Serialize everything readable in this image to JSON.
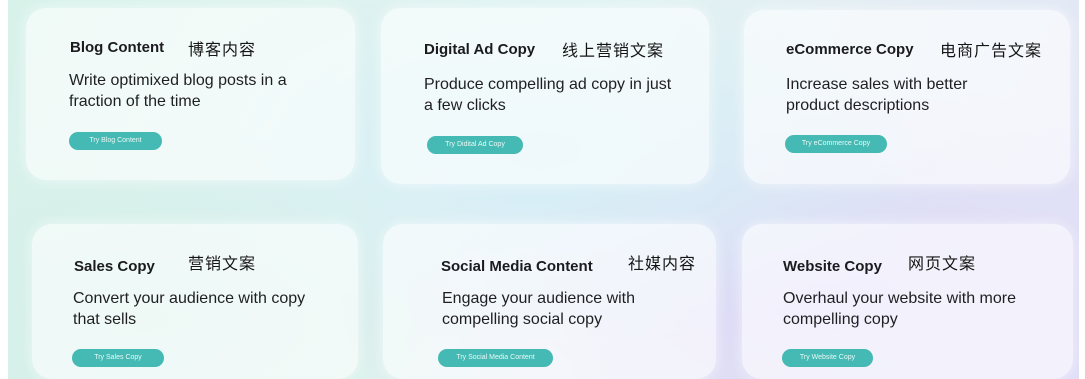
{
  "cards": [
    {
      "title": "Blog Content",
      "title_zh": "博客内容",
      "description": "Write optimixed blog posts in a fraction of the time",
      "button_label": "Try Blog Content"
    },
    {
      "title": "Digital Ad Copy",
      "title_zh": "线上营销文案",
      "description": "Produce compelling ad copy in just a few clicks",
      "button_label": "Try Didital Ad Copy"
    },
    {
      "title": "eCommerce Copy",
      "title_zh": "电商广告文案",
      "description": "Increase sales with better product descriptions",
      "button_label": "Try eCommerce Copy"
    },
    {
      "title": "Sales Copy",
      "title_zh": "营销文案",
      "description": "Convert your audience with copy that sells",
      "button_label": "Try Sales Copy"
    },
    {
      "title": "Social Media Content",
      "title_zh": "社媒内容",
      "description": "Engage your audience with compelling social copy",
      "button_label": "Try Social Media Content"
    },
    {
      "title": "Website Copy",
      "title_zh": "网页文案",
      "description": "Overhaul your website with more compelling copy",
      "button_label": "Try Website Copy"
    }
  ],
  "colors": {
    "button": "#45b9b3",
    "title": "#1b1b1f",
    "card": "#ffffff"
  }
}
